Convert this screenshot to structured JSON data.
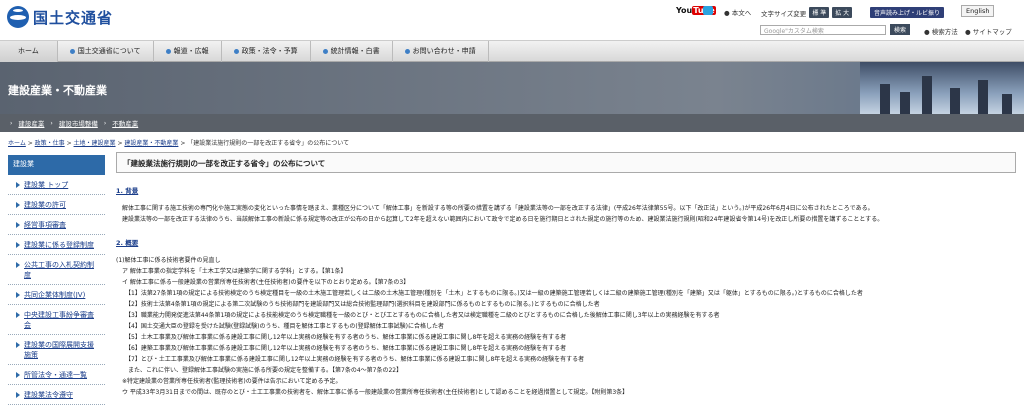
{
  "header": {
    "logo_text": "国土交通省",
    "youtube": "You",
    "youtube_tube": "Tube",
    "main_text": "● 本文へ",
    "font_size_label": "文字サイズ変更",
    "font_std": "標 準",
    "font_large": "拡 大",
    "speech": "音声読み上げ・ルビ振り",
    "english": "English",
    "search_placeholder": "Google\"カスタム検索",
    "search_button": "検索",
    "search_method": "● 検索方法",
    "sitemap": "● サイトマップ"
  },
  "nav": {
    "items": [
      "ホーム",
      "国土交通省について",
      "報道・広報",
      "政策・法令・予算",
      "統計情報・白書",
      "お問い合わせ・申請"
    ]
  },
  "banner": {
    "title": "建設産業・不動産業"
  },
  "subnav": {
    "items": [
      "建設産業",
      "建設市場整備",
      "不動産業"
    ]
  },
  "breadcrumb": {
    "items": [
      "ホーム",
      "政策・仕事",
      "土地・建設産業",
      "建設産業・不動産業"
    ],
    "current": "「建設業法施行規則の一部を改正する省令」の公布について"
  },
  "sidebar": {
    "header": "建設業",
    "items": [
      "建設業 トップ",
      "建設業の許可",
      "経営事項審査",
      "建設業に係る登録制度",
      "公共工事の入札契約制度",
      "共同企業体制度(JV)",
      "中央建設工事紛争審査会",
      "建設業の国際展開支援施策",
      "所管法令・通達一覧",
      "建設業法令遵守"
    ]
  },
  "main": {
    "title": "「建設業法施行規則の一部を改正する省令」の公布について",
    "sec1": "1. 背景",
    "sec1_p1": "解体工事に関する施工技術の専門化や施工実態の変化といった事情を踏まえ、業種区分について「解体工事」を新設する等の所要の措置を講ずる「建設業法等の一部を改正する法律」(平成26年法律第55号。以下「改正法」という。)が平成26年6月4日に公布されたところである。",
    "sec1_p2": "建設業法等の一部を改正する法律のうち、当該解体工事の新設に係る規定等の改正が公布の日から起算して2年を超えない範囲内において政令で定める日を施行期日とされた規定の施行等のため、建設業法施行規則(昭和24年建設省令第14号)を改正し所要の措置を講ずることとする。",
    "sec2": "2. 概要",
    "lines": [
      "(1)解体工事に係る技術者要件の見直し",
      "　ア 解体工事業の指定学科を「土木工学又は建築学に関する学科」とする。【第1条】",
      "　イ 解体工事に係る一般建設業の営業所専任技術者(主任技術者)の要件を以下のとおり定める。【第7条の3】",
      "　　【1】法第27条第1項の規定による技術検定のうち検定種目を一級の土木施工管理若しくは二級の土木施工管理(種別を「土木」とするものに限る。)又は一級の建築施工管理若しくは二級の建築施工管理(種別を「建築」又は「躯体」とするものに限る。)とするものに合格した者",
      "　　【2】技術士法第4条第1項の規定による第二次試験のうち技術部門を建設部門又は総合技術監理部門(選択科目を建設部門に係るものとするものに限る。)とするものに合格した者",
      "　　【3】職業能力開発促進法第44条第1項の規定による技能検定のうち検定職種を一級のとび・とび工とするものに合格した者又は検定職種を二級のとびとするものに合格した後解体工事に関し3年以上の実務経験を有する者",
      "　　【4】国土交通大臣の登録を受けた試験(登録試験)のうち、種目を解体工事とするもの(登録解体工事試験)に合格した者",
      "　　【5】土木工事業及び解体工事業に係る建設工事に関し12年以上実務の経験を有する者のうち、解体工事業に係る建設工事に関し8年を超える実務の経験を有する者",
      "　　【6】建築工事業及び解体工事業に係る建設工事に関し12年以上実務の経験を有する者のうち、解体工事業に係る建設工事に関し8年を超える実務の経験を有する者",
      "　　【7】とび・土工工事業及び解体工事業に係る建設工事に関し12年以上実務の経験を有する者のうち、解体工事業に係る建設工事に関し8年を超える実務の経験を有する者",
      "　　また、これに伴い、登録解体工事試験の実施に係る所要の規定を整備する。【第7条の4〜第7条の22】",
      "　※特定建設業の営業所専任技術者(監理技術者)の要件は告示において定める予定。",
      "　ウ 平成33年3月31日までの間は、既存のとび・土工工事業の技術者を、解体工事に係る一般建設業の営業所専任技術者(主任技術者)として認めることを経過措置として規定。【附則第3条】"
    ]
  },
  "colors": {
    "accent": "#2d6aa8",
    "link": "#1a3d8a",
    "banner": "#5a6370",
    "subnav": "#5a6068"
  }
}
